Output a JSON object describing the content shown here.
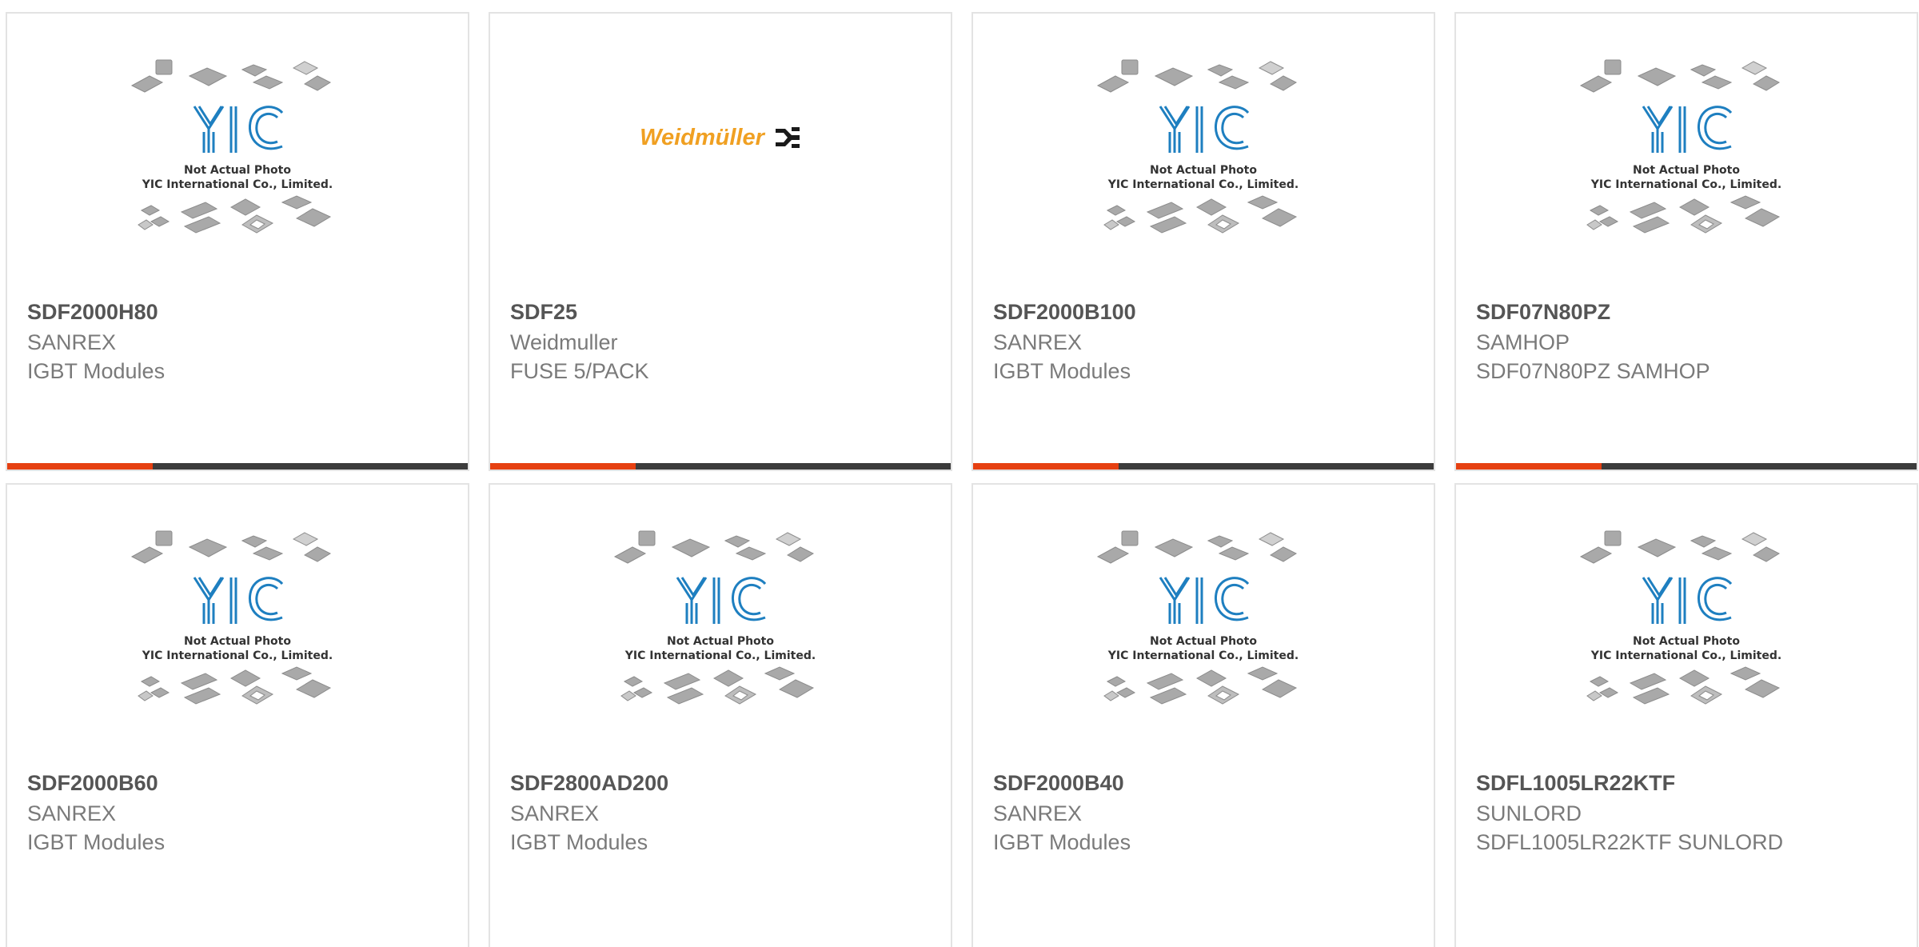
{
  "placeholder_image": {
    "logo_text": "YIC",
    "line1": "Not Actual Photo",
    "line2": "YIC International Co., Limited."
  },
  "colors": {
    "accent": "#e64011",
    "bar": "#3c3c3c",
    "card_border": "#e3e3e3",
    "yic_blue": "#1e7fc0",
    "weidmuller_orange": "#f0a022"
  },
  "products": [
    {
      "part": "SDF2000H80",
      "brand": "SANREX",
      "desc": "IGBT Modules",
      "image": "placeholder"
    },
    {
      "part": "SDF25",
      "brand": "Weidmuller",
      "desc": "FUSE 5/PACK",
      "image": "weidmuller-logo",
      "logo_text": "Weidmüller"
    },
    {
      "part": "SDF2000B100",
      "brand": "SANREX",
      "desc": "IGBT Modules",
      "image": "placeholder"
    },
    {
      "part": "SDF07N80PZ",
      "brand": "SAMHOP",
      "desc": "SDF07N80PZ SAMHOP",
      "image": "placeholder"
    },
    {
      "part": "SDF2000B60",
      "brand": "SANREX",
      "desc": "IGBT Modules",
      "image": "placeholder"
    },
    {
      "part": "SDF2800AD200",
      "brand": "SANREX",
      "desc": "IGBT Modules",
      "image": "placeholder"
    },
    {
      "part": "SDF2000B40",
      "brand": "SANREX",
      "desc": "IGBT Modules",
      "image": "placeholder"
    },
    {
      "part": "SDFL1005LR22KTF",
      "brand": "SUNLORD",
      "desc": "SDFL1005LR22KTF SUNLORD",
      "image": "placeholder"
    }
  ]
}
